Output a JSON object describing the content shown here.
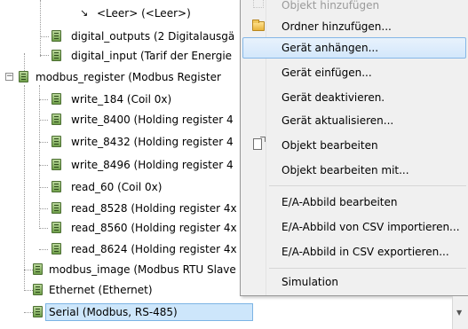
{
  "tree": {
    "nodes": [
      {
        "label": "<Leer> (<Leer>)"
      },
      {
        "label": "digital_outputs (2 Digitalausgä"
      },
      {
        "label": "digital_input (Tarif der Energie"
      },
      {
        "label": "modbus_register (Modbus Register"
      },
      {
        "label": "write_184 (Coil 0x)"
      },
      {
        "label": "write_8400 (Holding register 4"
      },
      {
        "label": "write_8432 (Holding register 4"
      },
      {
        "label": "write_8496 (Holding register 4"
      },
      {
        "label": "read_60 (Coil 0x)"
      },
      {
        "label": "read_8528 (Holding register 4x"
      },
      {
        "label": "read_8560 (Holding register 4x"
      },
      {
        "label": "read_8624 (Holding register 4x"
      },
      {
        "label": "modbus_image (Modbus RTU Slave"
      },
      {
        "label": "Ethernet (Ethernet)"
      },
      {
        "label": "Serial (Modbus, RS-485)"
      }
    ]
  },
  "context_menu": {
    "items": [
      {
        "label": "Objekt hinzufügen",
        "icon": "grid-icon",
        "state": "disabled"
      },
      {
        "label": "Ordner hinzufügen...",
        "icon": "folder-icon",
        "state": "normal"
      },
      {
        "label": "Gerät anhängen...",
        "state": "highlighted"
      },
      {
        "label": "Gerät einfügen...",
        "state": "normal"
      },
      {
        "label": "Gerät deaktivieren.",
        "state": "normal"
      },
      {
        "label": "Gerät aktualisieren...",
        "state": "normal"
      },
      {
        "label": "Objekt bearbeiten",
        "icon": "edit-object-icon",
        "state": "normal"
      },
      {
        "label": "Objekt bearbeiten mit...",
        "state": "normal"
      },
      {
        "label": "E/A-Abbild bearbeiten",
        "state": "normal"
      },
      {
        "label": "E/A-Abbild von CSV importieren...",
        "state": "normal"
      },
      {
        "label": "E/A-Abbild in CSV exportieren...",
        "state": "normal"
      },
      {
        "label": "Simulation",
        "state": "normal"
      }
    ]
  },
  "colors": {
    "selection_fill": "#cde6fb",
    "selection_border": "#7cb4e4",
    "menu_background": "#f0f0f0",
    "menu_highlight_border": "#85b7e7",
    "device_icon_green": "#6f9f4a"
  }
}
